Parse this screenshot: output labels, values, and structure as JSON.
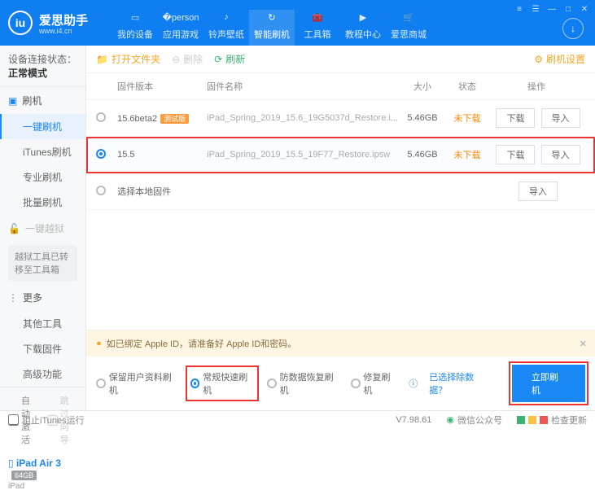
{
  "app": {
    "name": "爱思助手",
    "subtitle": "www.i4.cn",
    "logo_letter": "iu"
  },
  "nav": {
    "items": [
      "我的设备",
      "应用游戏",
      "铃声壁纸",
      "智能刷机",
      "工具箱",
      "教程中心",
      "爱思商城"
    ],
    "active_index": 3
  },
  "sidebar": {
    "conn_label": "设备连接状态：",
    "conn_value": "正常模式",
    "flash_group": "刷机",
    "flash_items": [
      "一键刷机",
      "iTunes刷机",
      "专业刷机",
      "批量刷机"
    ],
    "jailbreak_group": "一键越狱",
    "jailbreak_note": "越狱工具已转移至工具箱",
    "more_group": "更多",
    "more_items": [
      "其他工具",
      "下载固件",
      "高级功能"
    ],
    "opt_auto": "自动激活",
    "opt_skip": "跳过向导",
    "device": {
      "name": "iPad Air 3",
      "storage": "64GB",
      "type": "iPad"
    }
  },
  "toolbar": {
    "open": "打开文件夹",
    "delete": "删除",
    "refresh": "刷新",
    "settings": "刷机设置"
  },
  "table": {
    "headers": {
      "version": "固件版本",
      "name": "固件名称",
      "size": "大小",
      "state": "状态",
      "ops": "操作"
    },
    "rows": [
      {
        "selected": false,
        "version": "15.6beta2",
        "beta": "测试版",
        "filename": "iPad_Spring_2019_15.6_19G5037d_Restore.i...",
        "size": "5.46GB",
        "state": "未下载"
      },
      {
        "selected": true,
        "version": "15.5",
        "beta": "",
        "filename": "iPad_Spring_2019_15.5_19F77_Restore.ipsw",
        "size": "5.46GB",
        "state": "未下载"
      }
    ],
    "local_row": "选择本地固件",
    "btn_download": "下载",
    "btn_import": "导入"
  },
  "bottom": {
    "warning": "如已绑定 Apple ID，请准备好 Apple ID和密码。",
    "modes": [
      "保留用户资料刷机",
      "常规快速刷机",
      "防数据恢复刷机",
      "修复刷机"
    ],
    "selected_mode": 1,
    "exclude_link": "已选择除数据？",
    "flash_btn": "立即刷机"
  },
  "statusbar": {
    "block_itunes": "阻止iTunes运行",
    "version": "V7.98.61",
    "wechat": "微信公众号",
    "check_update": "检查更新"
  }
}
